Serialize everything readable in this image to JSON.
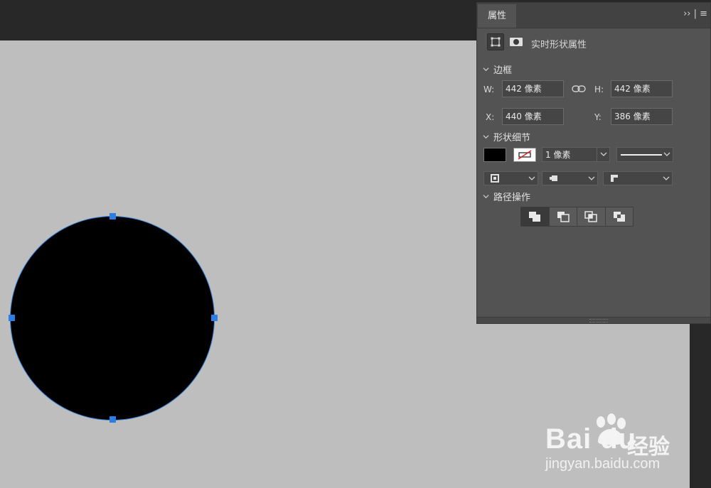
{
  "panel": {
    "tab_label": "属性",
    "menu_glyph": "›› | ≡",
    "mode_title": "实时形状属性",
    "bounds": {
      "section_label": "边框",
      "w_label": "W:",
      "w_value": "442 像素",
      "h_label": "H:",
      "h_value": "442 像素",
      "x_label": "X:",
      "x_value": "440 像素",
      "y_label": "Y:",
      "y_value": "386 像素"
    },
    "shape_details": {
      "section_label": "形状细节",
      "fill_color": "#000000",
      "stroke_width": "1 像素"
    },
    "path_ops": {
      "section_label": "路径操作"
    }
  },
  "watermark": {
    "brand": "Bai du",
    "cn": "经验",
    "url": "jingyan.baidu.com"
  },
  "icons": [
    "transform-icon",
    "mask-icon",
    "link-icon",
    "chevron-down-icon",
    "stroke-align-icon",
    "stroke-cap-icon",
    "stroke-corner-icon",
    "combine-shapes-icon",
    "subtract-shape-icon",
    "intersect-shape-icon",
    "exclude-overlap-icon"
  ]
}
